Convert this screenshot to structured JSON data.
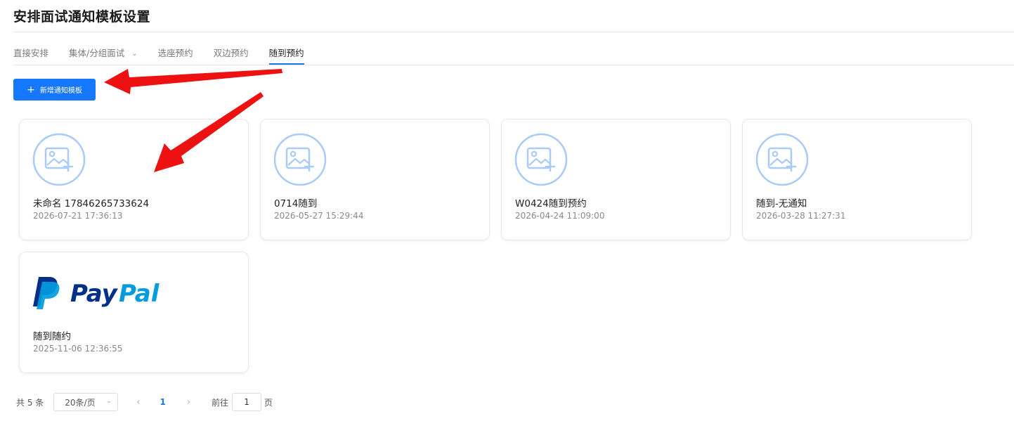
{
  "page": {
    "title": "安排面试通知模板设置"
  },
  "tabs": [
    {
      "label": "直接安排",
      "active": false
    },
    {
      "label": "集体/分组面试",
      "active": false,
      "dropdown_icon": "chevron-down-icon"
    },
    {
      "label": "选座预约",
      "active": false
    },
    {
      "label": "双边预约",
      "active": false
    },
    {
      "label": "随到预约",
      "active": true
    }
  ],
  "toolbar": {
    "add_icon": "plus-icon",
    "add_label": "新增通知模板"
  },
  "templates": [
    {
      "name": "未命名 17846265733624",
      "time": "2026-07-21 17:36:13",
      "thumbnail": "image-placeholder-icon"
    },
    {
      "name": "0714随到",
      "time": "2026-05-27 15:29:44",
      "thumbnail": "image-placeholder-icon"
    },
    {
      "name": "W0424随到预约",
      "time": "2026-04-24 11:09:00",
      "thumbnail": "image-placeholder-icon"
    },
    {
      "name": "随到-无通知",
      "time": "2026-03-28 11:27:31",
      "thumbnail": "image-placeholder-icon"
    },
    {
      "name": "随到随约",
      "time": "2025-11-06 12:36:55",
      "thumbnail": "paypal-logo",
      "logo_text": "PayPal"
    }
  ],
  "pagination": {
    "total_label": "共 5 条",
    "page_size": "20条/页",
    "current_page": "1",
    "goto_label": "前往",
    "goto_value": "1",
    "goto_suffix": "页"
  },
  "colors": {
    "accent": "#1677ff",
    "placeholder_icon": "#a9cbf5",
    "annotation_arrow": "#ee1111",
    "paypal_dark": "#003087",
    "paypal_light": "#009cde"
  }
}
